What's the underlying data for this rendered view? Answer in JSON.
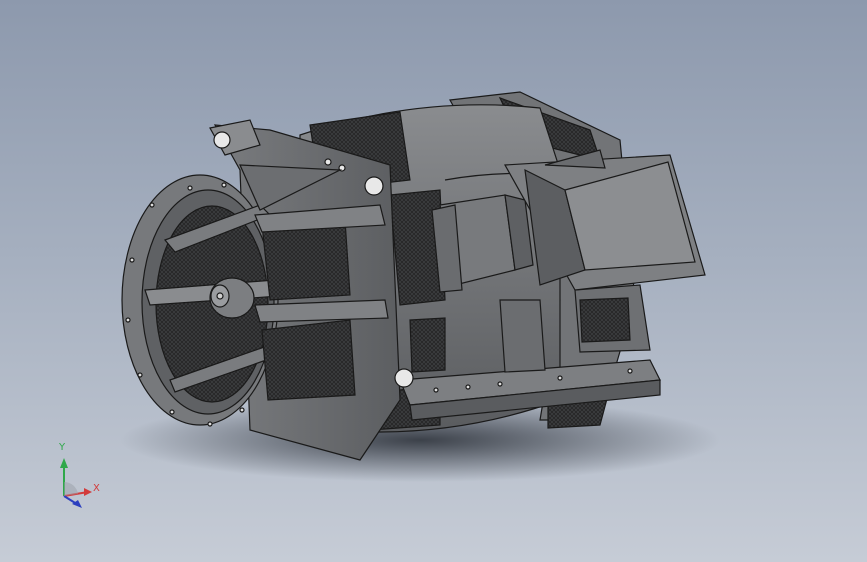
{
  "viewport": {
    "background_top": "#8d99ad",
    "background_bottom": "#c6ccd6"
  },
  "model": {
    "icon": "generator-3d-model",
    "body_color": "#6d6f72",
    "edge_color": "#1a1a1a",
    "mesh_color": "#2a2a2a"
  },
  "triad": {
    "icon": "axis-triad-icon",
    "y_label": "Y",
    "x_label": "X",
    "y_color": "#2fa84a",
    "x_color": "#d23b3b",
    "z_color": "#2b3fbf"
  }
}
